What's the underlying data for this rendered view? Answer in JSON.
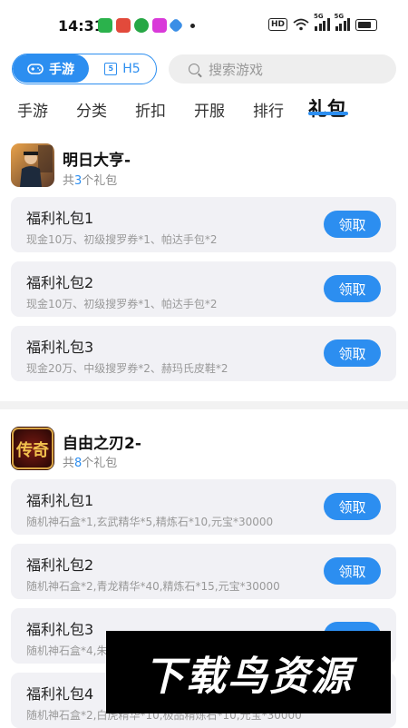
{
  "status_bar": {
    "time": "14:31",
    "hd": "HD",
    "sim1": "5G",
    "sim2": "5G"
  },
  "header": {
    "mobile_tab_label": "手游",
    "h5_tab_label": "H5",
    "search_placeholder": "搜索游戏"
  },
  "tabs": [
    "手游",
    "分类",
    "折扣",
    "开服",
    "排行",
    "礼包"
  ],
  "active_tab": "礼包",
  "games": [
    {
      "name": "明日大亨-",
      "count_prefix": "共",
      "count": "3",
      "count_suffix": "个礼包",
      "gifts": [
        {
          "title": "福利礼包1",
          "desc": "现金10万、初级搜罗券*1、帕达手包*2",
          "button": "领取"
        },
        {
          "title": "福利礼包2",
          "desc": "现金10万、初级搜罗券*1、帕达手包*2",
          "button": "领取"
        },
        {
          "title": "福利礼包3",
          "desc": "现金20万、中级搜罗券*2、赫玛氏皮鞋*2",
          "button": "领取"
        }
      ]
    },
    {
      "name": "自由之刃2-",
      "icon_text": "传奇",
      "count_prefix": "共",
      "count": "8",
      "count_suffix": "个礼包",
      "gifts": [
        {
          "title": "福利礼包1",
          "desc": "随机神石盒*1,玄武精华*5,精炼石*10,元宝*30000",
          "button": "领取"
        },
        {
          "title": "福利礼包2",
          "desc": "随机神石盒*2,青龙精华*40,精炼石*15,元宝*30000",
          "button": "领取"
        },
        {
          "title": "福利礼包3",
          "desc": "随机神石盒*4,朱",
          "button": ""
        },
        {
          "title": "福利礼包4",
          "desc": "随机神石盒*2,白虎精华*10,极品精炼石*10,元宝*30000",
          "button": ""
        }
      ]
    }
  ],
  "watermark": "下载鸟资源",
  "colors": {
    "accent": "#2c8ef0",
    "card_bg": "#f1f1f5"
  }
}
